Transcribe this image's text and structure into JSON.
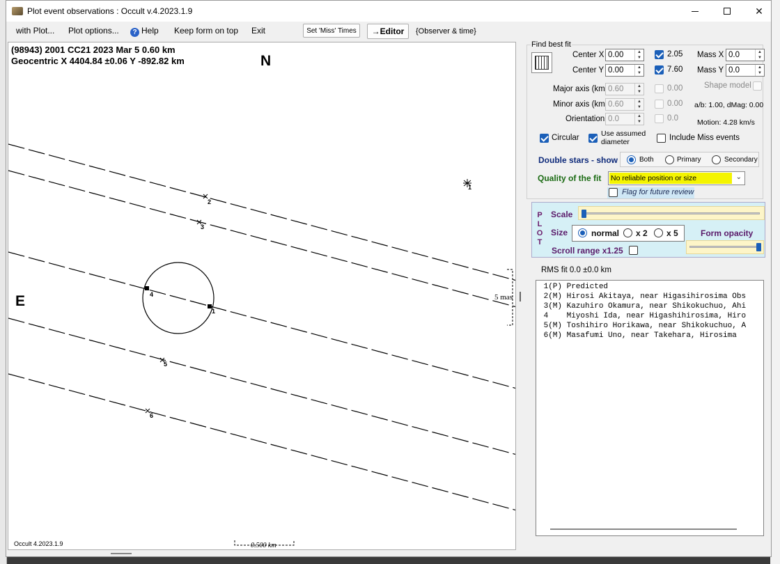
{
  "window": {
    "title": "Plot event observations : Occult v.4.2023.1.9"
  },
  "menu": {
    "with_plot": "with Plot...",
    "plot_options": "Plot options...",
    "help": "Help",
    "keep_on_top": "Keep form on top",
    "exit": "Exit",
    "set_miss_times": "Set 'Miss' Times",
    "editor": "→Editor",
    "observer_time": "{Observer & time}"
  },
  "plot": {
    "header_line1": "(98943) 2001 CC21  2023 Mar 5   0.60 km",
    "header_line2": "Geocentric  X  4404.84 ±0.06  Y -892.82 km",
    "north_label": "N",
    "east_label": "E",
    "version_note": "Occult 4.2023.1.9",
    "scale_label": "0.500 km",
    "mas_label": "5 mas",
    "chord_labels": [
      "1",
      "2",
      "3",
      "4",
      "1",
      "5",
      "6"
    ]
  },
  "fit": {
    "group_title": "Find best fit",
    "center_x_label": "Center X",
    "center_x_value": "0.00",
    "center_y_label": "Center Y",
    "center_y_value": "0.00",
    "check_x_value": "2.05",
    "check_y_value": "7.60",
    "mass_x_label": "Mass X",
    "mass_x_value": "0.0",
    "mass_y_label": "Mass Y",
    "mass_y_value": "0.0",
    "major_label": "Major axis (km)",
    "major_value": "0.60",
    "major_check_value": "0.00",
    "minor_label": "Minor axis (km)",
    "minor_value": "0.60",
    "minor_check_value": "0.00",
    "orientation_label": "Orientation",
    "orientation_value": "0.0",
    "orientation_check_value": "0.0",
    "shape_model_label": "Shape model",
    "ab_text": "a/b: 1.00, dMag: 0.00",
    "motion_text": "Motion: 4.28 km/s",
    "circular_label": "Circular",
    "assumed_label_1": "Use assumed",
    "assumed_label_2": "diameter",
    "include_miss_label": "Include Miss events"
  },
  "double_stars": {
    "label": "Double stars - show",
    "both": "Both",
    "primary": "Primary",
    "secondary": "Secondary"
  },
  "quality": {
    "label": "Quality of the fit",
    "value": "No reliable position or size",
    "flag_label": "Flag for future review"
  },
  "plot_controls": {
    "vertical_label": "P\nL\nO\nT",
    "scale_label": "Scale",
    "size_label": "Size",
    "size_normal": "normal",
    "size_x2": "x 2",
    "size_x5": "x 5",
    "opacity_label": "Form opacity",
    "scroll_label": "Scroll range x1.25",
    "scale_level": 0.0,
    "opacity_level": 1.0
  },
  "rms_text": "RMS fit 0.0 ±0.0 km",
  "observers": [
    " 1(P) Predicted",
    " 2(M) Hirosi Akitaya, near Higasihirosima Obs",
    " 3(M) Kazuhiro Okamura, near Shikokuchuo, Ahi",
    " 4    Miyoshi Ida, near Higashihirosima, Hiro",
    " 5(M) Toshihiro Horikawa, near Shikokuchuo, A",
    " 6(M) Masafumi Uno, near Takehara, Hirosima"
  ],
  "colors": {
    "accent": "#1b5fb8",
    "quality_bg": "#f4f400",
    "double_stars_text": "#0e2a7a",
    "quality_text": "#1a6a12",
    "plot_panel_bg": "#d6f0f6"
  }
}
